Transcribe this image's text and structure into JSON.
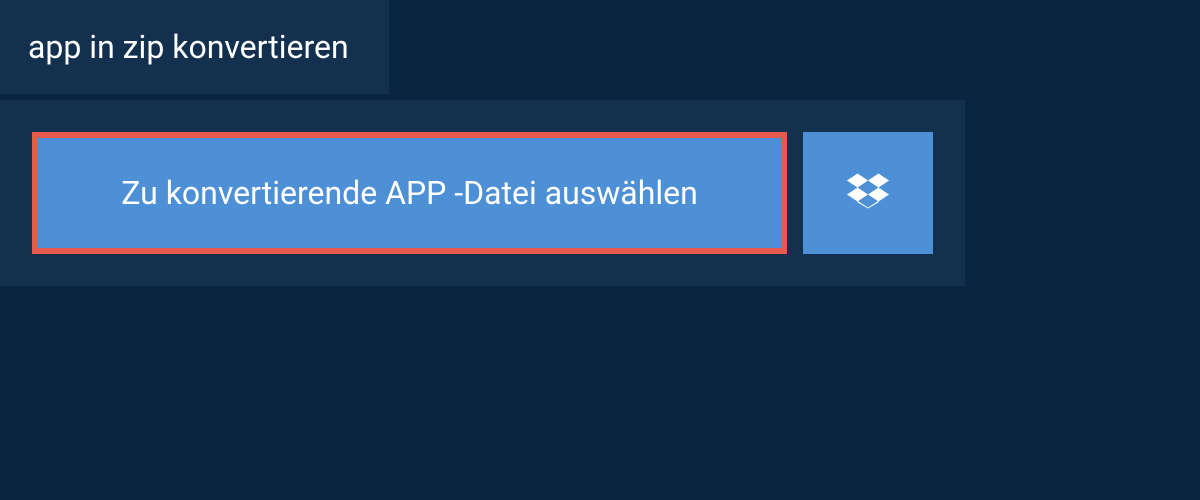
{
  "tab": {
    "label": "app in zip konvertieren"
  },
  "upload": {
    "select_button_label": "Zu konvertierende APP -Datei auswählen"
  },
  "colors": {
    "bg_dark": "#0a2540",
    "panel": "#13314f",
    "button_blue": "#4d90d6",
    "highlight_border": "#e85a4f",
    "text": "#ffffff"
  }
}
